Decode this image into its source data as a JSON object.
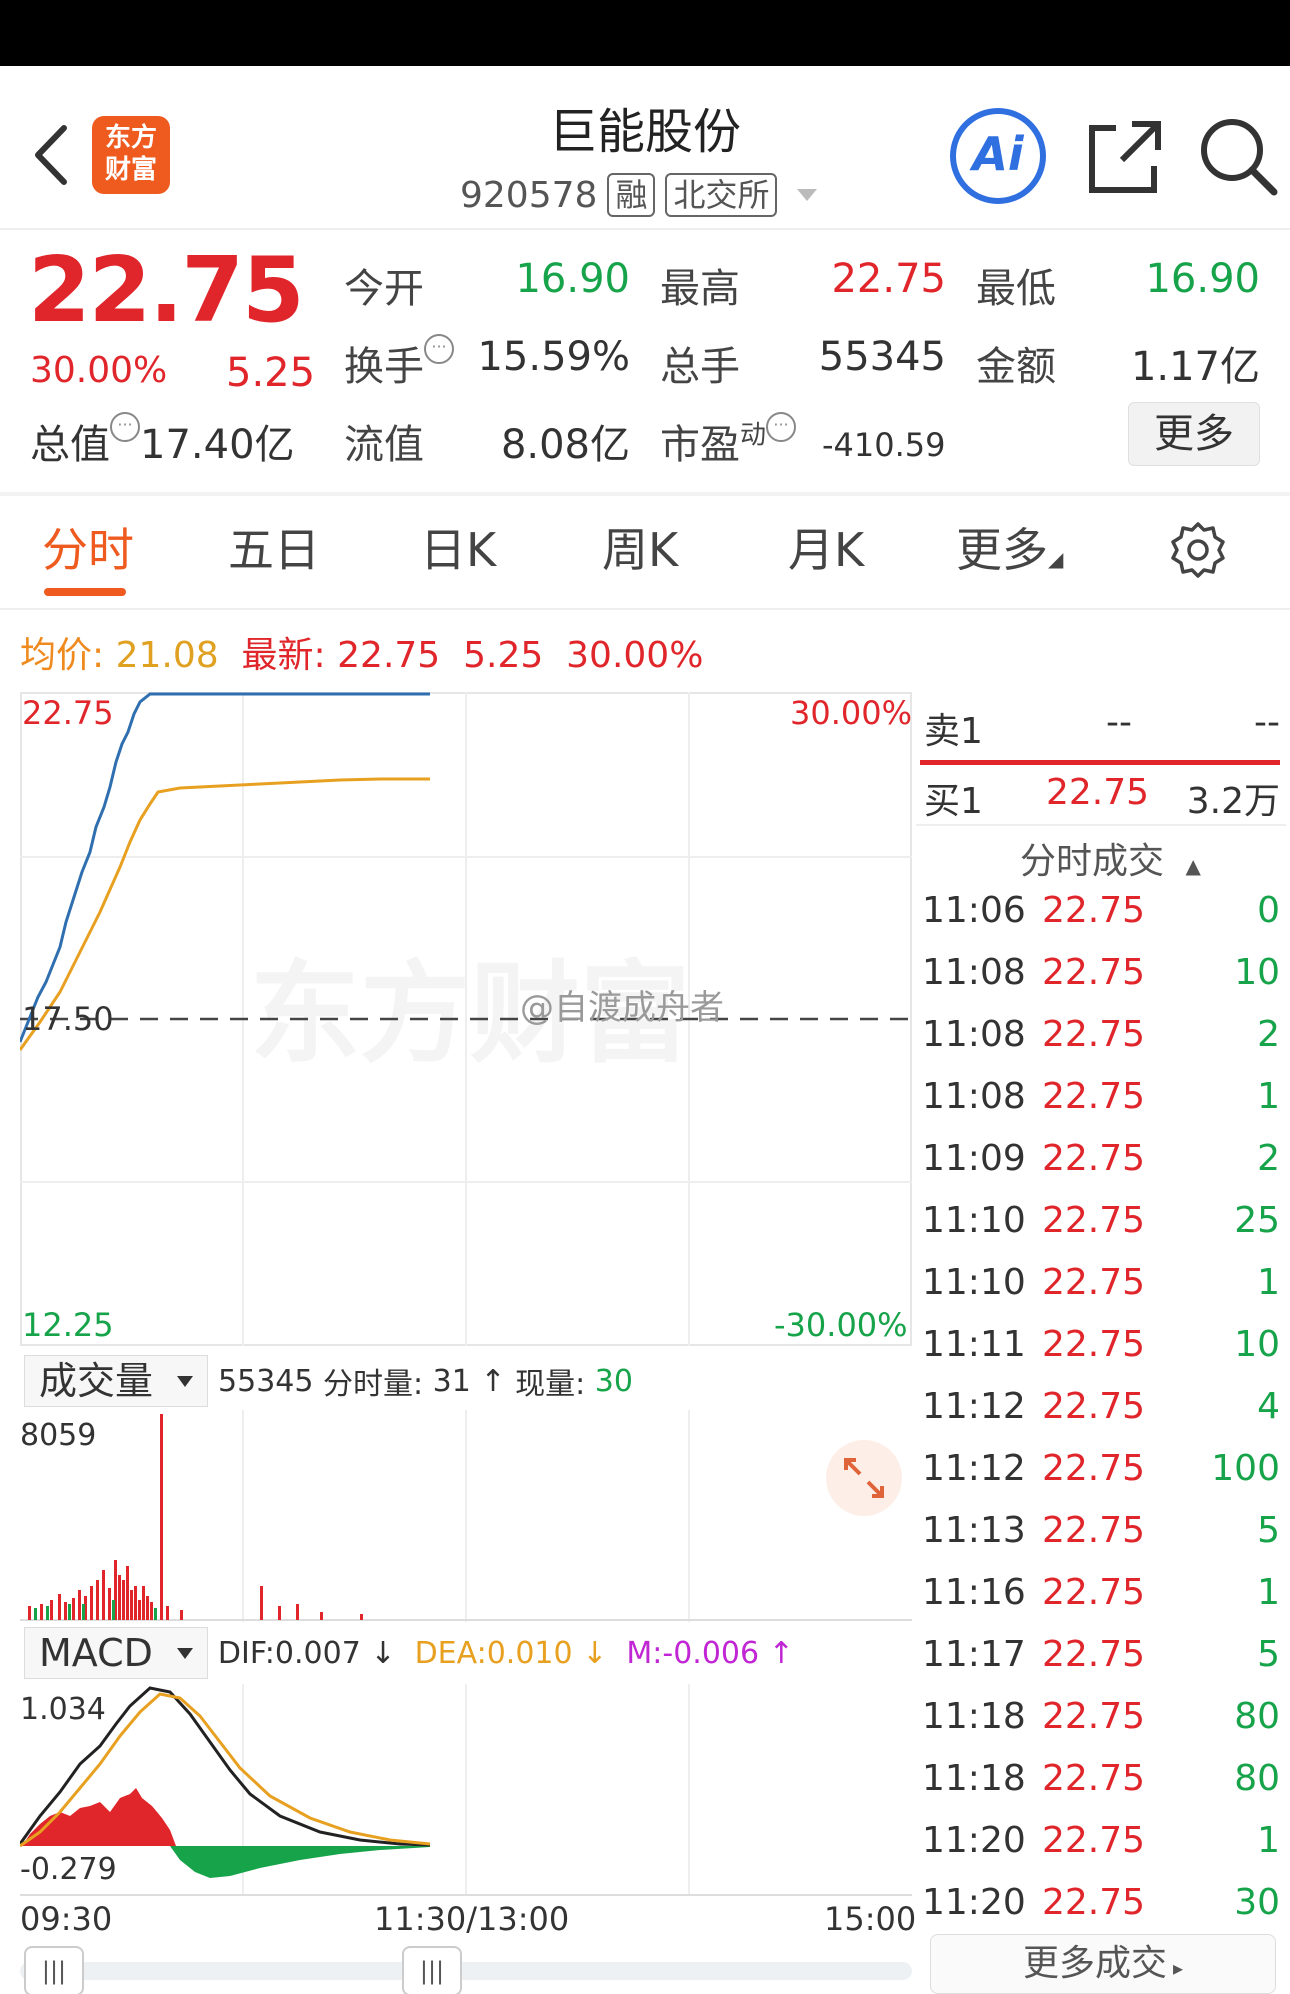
{
  "header": {
    "logo_line1": "东方",
    "logo_line2": "财富",
    "stock_name": "巨能股份",
    "stock_code": "920578",
    "tag_margin": "融",
    "tag_exchange": "北交所",
    "ai_label": "Ai"
  },
  "quote": {
    "price": "22.75",
    "change_pct": "30.00%",
    "change": "5.25",
    "total_mv_label": "总值",
    "total_mv": "17.40亿",
    "open_label": "今开",
    "open": "16.90",
    "high_label": "最高",
    "high": "22.75",
    "low_label": "最低",
    "low": "16.90",
    "turnover_label": "换手",
    "turnover": "15.59%",
    "volume_label": "总手",
    "volume": "55345",
    "amount_label": "金额",
    "amount": "1.17亿",
    "float_mv_label": "流值",
    "float_mv": "8.08亿",
    "pe_label": "市盈",
    "pe_sup": "动",
    "pe": "-410.59",
    "more_label": "更多"
  },
  "tabs": [
    "分时",
    "五日",
    "日K",
    "周K",
    "月K",
    "更多"
  ],
  "info": {
    "avg_label": "均价:",
    "avg": "21.08",
    "latest_label": "最新:",
    "latest": "22.75",
    "change": "5.25",
    "pct": "30.00%"
  },
  "chart": {
    "y_top": "22.75",
    "y_mid": "17.50",
    "y_bottom": "12.25",
    "pct_top": "30.00%",
    "pct_bottom": "-30.00%",
    "x_start": "09:30",
    "x_mid": "11:30/13:00",
    "x_end": "15:00",
    "watermark": "@自渡成舟者",
    "bg_watermark": "东方财富"
  },
  "volume_panel": {
    "selector": "成交量",
    "total": "55345",
    "period_label": "分时量:",
    "period_val": "31",
    "current_label": "现量:",
    "current_val": "30",
    "y_max": "8059"
  },
  "macd_panel": {
    "selector": "MACD",
    "dif": "DIF:0.007",
    "dea": "DEA:0.010",
    "m": "M:-0.006",
    "y_max": "1.034",
    "y_min": "-0.279"
  },
  "orderbook": {
    "sell1_label": "卖1",
    "sell1_price": "--",
    "sell1_vol": "--",
    "buy1_label": "买1",
    "buy1_price": "22.75",
    "buy1_vol": "3.2万",
    "trades_title": "分时成交",
    "more_trades": "更多成交"
  },
  "trades": [
    {
      "time": "11:06",
      "price": "22.75",
      "vol": "0"
    },
    {
      "time": "11:08",
      "price": "22.75",
      "vol": "10"
    },
    {
      "time": "11:08",
      "price": "22.75",
      "vol": "2"
    },
    {
      "time": "11:08",
      "price": "22.75",
      "vol": "1"
    },
    {
      "time": "11:09",
      "price": "22.75",
      "vol": "2"
    },
    {
      "time": "11:10",
      "price": "22.75",
      "vol": "25"
    },
    {
      "time": "11:10",
      "price": "22.75",
      "vol": "1"
    },
    {
      "time": "11:11",
      "price": "22.75",
      "vol": "10"
    },
    {
      "time": "11:12",
      "price": "22.75",
      "vol": "4"
    },
    {
      "time": "11:12",
      "price": "22.75",
      "vol": "100"
    },
    {
      "time": "11:13",
      "price": "22.75",
      "vol": "5"
    },
    {
      "time": "11:16",
      "price": "22.75",
      "vol": "1"
    },
    {
      "time": "11:17",
      "price": "22.75",
      "vol": "5"
    },
    {
      "time": "11:18",
      "price": "22.75",
      "vol": "80"
    },
    {
      "time": "11:18",
      "price": "22.75",
      "vol": "80"
    },
    {
      "time": "11:20",
      "price": "22.75",
      "vol": "1"
    },
    {
      "time": "11:20",
      "price": "22.75",
      "vol": "30"
    }
  ],
  "colors": {
    "up": "#e0262b",
    "down": "#16a34a",
    "accent": "#ef5a1f",
    "price_line": "#2f6fb0",
    "avg_line": "#e8a020"
  }
}
